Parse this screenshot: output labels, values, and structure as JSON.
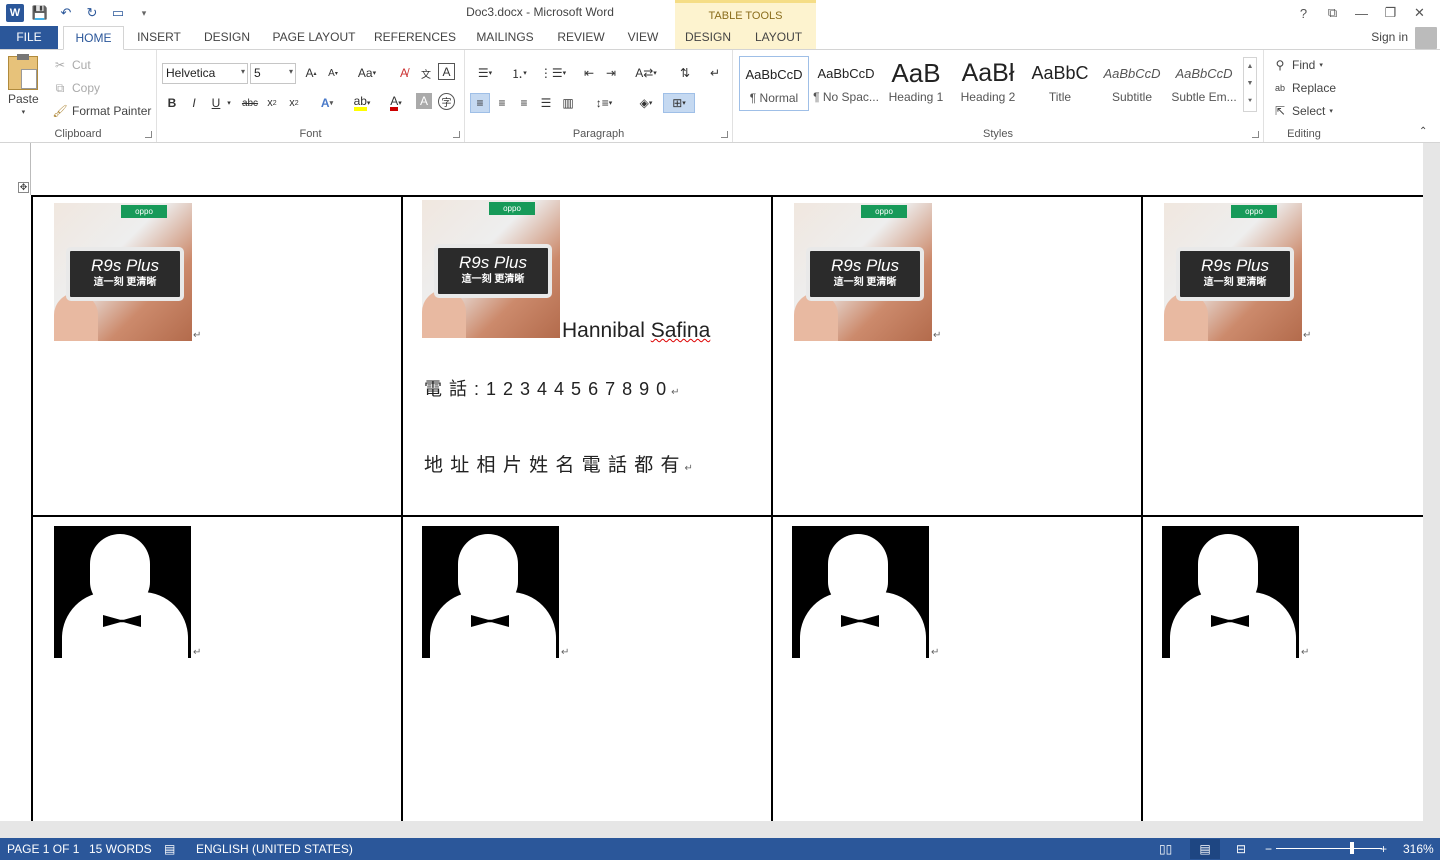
{
  "window": {
    "title": "Doc3.docx - Microsoft Word",
    "contextual_header": "TABLE TOOLS",
    "controls": [
      "?",
      "⧉",
      "—",
      "❐",
      "✕"
    ]
  },
  "tabs": [
    {
      "label": "FILE",
      "kind": "file"
    },
    {
      "label": "HOME",
      "kind": "active"
    },
    {
      "label": "INSERT"
    },
    {
      "label": "DESIGN"
    },
    {
      "label": "PAGE LAYOUT"
    },
    {
      "label": "REFERENCES"
    },
    {
      "label": "MAILINGS"
    },
    {
      "label": "REVIEW"
    },
    {
      "label": "VIEW"
    },
    {
      "label": "DESIGN",
      "kind": "table-tools"
    },
    {
      "label": "LAYOUT",
      "kind": "table-tools"
    }
  ],
  "signin": "Sign in",
  "ribbon": {
    "clipboard": {
      "label": "Clipboard",
      "paste": "Paste",
      "cut": "Cut",
      "copy": "Copy",
      "format_painter": "Format Painter"
    },
    "font": {
      "label": "Font",
      "font_name": "Helvetica",
      "font_size": "5",
      "change_case": "Aa"
    },
    "paragraph": {
      "label": "Paragraph"
    },
    "styles": {
      "label": "Styles",
      "items": [
        {
          "preview": "AaBbCcD",
          "name": "¶ Normal",
          "selected": true
        },
        {
          "preview": "AaBbCcD",
          "name": "¶ No Spac..."
        },
        {
          "preview": "AaB",
          "name": "Heading 1"
        },
        {
          "preview": "AaBł",
          "name": "Heading 2"
        },
        {
          "preview": "AaBbC",
          "name": "Title"
        },
        {
          "preview": "AaBbCcD",
          "name": "Subtitle"
        },
        {
          "preview": "AaBbCcD",
          "name": "Subtle Em..."
        }
      ]
    },
    "editing": {
      "label": "Editing",
      "find": "Find",
      "replace": "Replace",
      "select": "Select"
    }
  },
  "document": {
    "card": {
      "brand": "oppo",
      "model": "R9s Plus",
      "slogan": "這一刻 更清晰",
      "name": "Hannibal Safina",
      "phone": "電 話 : 1 2 3 4 4 5 6 7 8 9 0",
      "address": "地 址 相 片 姓 名 電 話 都 有",
      "para_mark": "↵"
    }
  },
  "status": {
    "page": "PAGE 1 OF 1",
    "words": "15 WORDS",
    "language": "ENGLISH (UNITED STATES)",
    "zoom": "316%"
  }
}
